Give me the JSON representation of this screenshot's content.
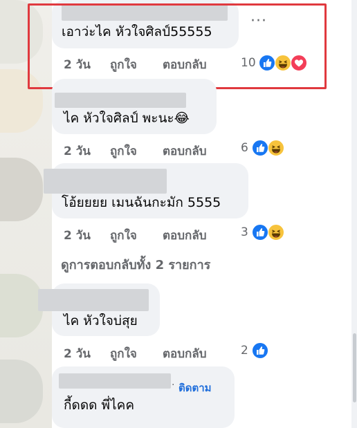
{
  "comments": [
    {
      "text": "เอาว่ะไค หัวใจศิลป์55555",
      "time": "2 วัน",
      "like": "ถูกใจ",
      "reply": "ตอบกลับ",
      "reaction_count": "10",
      "reactions": [
        "like-icon",
        "haha-icon",
        "love-icon"
      ]
    },
    {
      "text": "ไค หัวใจศิลป์ พะนะ😂",
      "time": "2 วัน",
      "like": "ถูกใจ",
      "reply": "ตอบกลับ",
      "reaction_count": "6",
      "reactions": [
        "like-icon",
        "haha-icon"
      ]
    },
    {
      "text": "โอ้ยยยย เมนฉันกะมัก 5555",
      "time": "2 วัน",
      "like": "ถูกใจ",
      "reply": "ตอบกลับ",
      "reaction_count": "3",
      "reactions": [
        "like-icon",
        "haha-icon"
      ]
    },
    {
      "text": "ไค หัวใจบ่สุย",
      "time": "2 วัน",
      "like": "ถูกใจ",
      "reply": "ตอบกลับ",
      "reaction_count": "2",
      "reactions": [
        "like-icon"
      ]
    },
    {
      "text": "กี้ดดด พี่ไคค",
      "follow": "ติดตาม",
      "dot": "·"
    }
  ],
  "view_replies": "ดูการตอบกลับทั้ง 2 รายการ",
  "more_options": "···",
  "colors": {
    "bubble": "#f0f2f5",
    "meta_text": "#65676b",
    "link": "#216fdb",
    "highlight": "#e0393e",
    "like": "#1877f2",
    "haha": "#f7c33c",
    "love": "#f33e58"
  }
}
